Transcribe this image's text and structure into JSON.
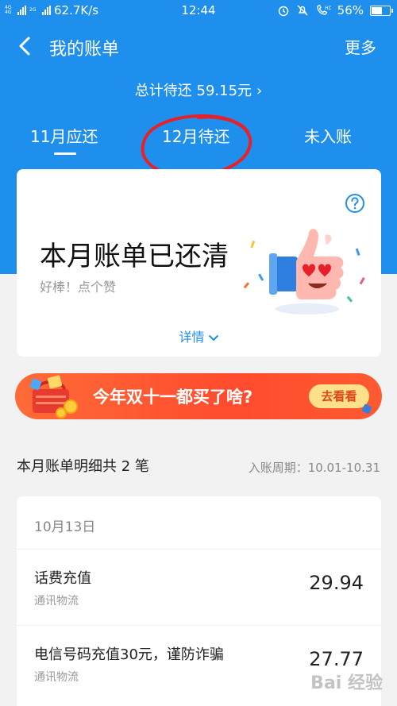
{
  "status_bar": {
    "network_label": "4G 4G",
    "network2_label": "2G",
    "speed": "62.7K/s",
    "time": "12:44",
    "battery": "56%",
    "battery_level": 0.56
  },
  "header": {
    "back_icon": "chevron-left-icon",
    "title": "我的账单",
    "more": "更多"
  },
  "total_due": {
    "text": "总计待还 59.15元",
    "chevron": "›"
  },
  "tabs": [
    {
      "label": "11月应还",
      "active": true
    },
    {
      "label": "12月待还",
      "active": false
    },
    {
      "label": "未入账",
      "active": false
    }
  ],
  "summary_card": {
    "help_icon": "question-circle-icon",
    "title": "本月账单已还清",
    "subtitle": "好棒！点个赞",
    "details_label": "详情",
    "illustration": "thumbs-up-icon"
  },
  "banner": {
    "text": "今年双十一都买了啥?",
    "button": "去看看",
    "illustration": "shopping-basket-icon"
  },
  "bill_section": {
    "title": "本月账单明细共 2 笔",
    "period": "入账周期：10.01-10.31"
  },
  "transactions": {
    "date": "10月13日",
    "items": [
      {
        "name": "话费充值",
        "category": "通讯物流",
        "amount": "29.94"
      },
      {
        "name": "电信号码充值30元，谨防诈骗",
        "category": "通讯物流",
        "amount": "27.77"
      }
    ]
  },
  "watermark": "Bai 经验",
  "colors": {
    "primary_blue": "#1f8fee",
    "banner_orange": "#ff5a31",
    "annotation_red": "#e8202a"
  }
}
